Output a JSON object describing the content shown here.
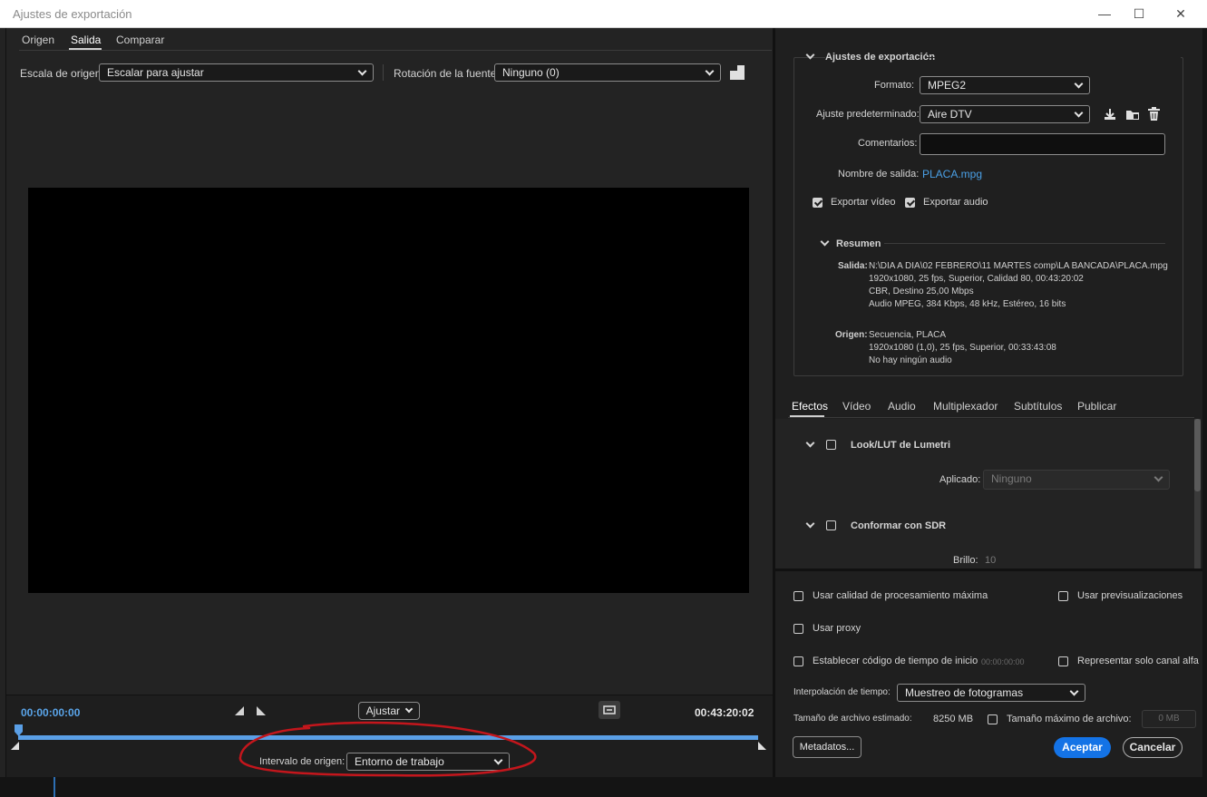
{
  "window": {
    "title": "Ajustes de exportación",
    "minimize": "—",
    "maximize": "☐",
    "close": "✕"
  },
  "left_tabs": [
    "Origen",
    "Salida",
    "Comparar"
  ],
  "source_scale": {
    "label": "Escala de origen:",
    "value": "Escalar para ajustar"
  },
  "rotation": {
    "label": "Rotación de la fuente:",
    "value": "Ninguno (0)"
  },
  "timeline": {
    "current_tc": "00:00:00:00",
    "end_tc": "00:43:20:02",
    "fit_label": "Ajustar",
    "source_range_label": "Intervalo de origen:",
    "source_range_value": "Entorno de trabajo",
    "playhead_progress": 0
  },
  "export_settings": {
    "header": "Ajustes de exportación",
    "format_label": "Formato:",
    "format_value": "MPEG2",
    "preset_label": "Ajuste predeterminado:",
    "preset_value": "Aire DTV",
    "comments_label": "Comentarios:",
    "comments_value": "",
    "output_name_label": "Nombre de salida:",
    "output_name_value": "PLACA.mpg",
    "export_video_label": "Exportar vídeo",
    "export_audio_label": "Exportar audio"
  },
  "summary": {
    "header": "Resumen",
    "output_label": "Salida:",
    "output_lines": [
      "N:\\DIA A DIA\\02 FEBRERO\\11 MARTES comp\\LA BANCADA\\PLACA.mpg",
      "1920x1080, 25 fps, Superior, Calidad 80, 00:43:20:02",
      "CBR, Destino 25,00 Mbps",
      "Audio MPEG, 384 Kbps, 48 kHz, Estéreo, 16 bits"
    ],
    "source_label": "Origen:",
    "source_lines": [
      "Secuencia, PLACA",
      "1920x1080 (1,0), 25 fps, Superior, 00:33:43:08",
      "No hay ningún audio"
    ]
  },
  "right_tabs": [
    "Efectos",
    "Vídeo",
    "Audio",
    "Multiplexador",
    "Subtítulos",
    "Publicar"
  ],
  "effects": {
    "lumetri_label": "Look/LUT de Lumetri",
    "applied_label": "Aplicado:",
    "applied_value": "Ninguno",
    "sdr_label": "Conformar con SDR",
    "brightness_label": "Brillo:",
    "brightness_value": "10"
  },
  "options": {
    "max_quality": "Usar calidad de procesamiento máxima",
    "use_previews": "Usar previsualizaciones",
    "use_proxy": "Usar proxy",
    "start_timecode": "Establecer código de tiempo de inicio",
    "start_timecode_value": "00:00:00:00",
    "alpha_only": "Representar solo canal alfa",
    "time_interp_label": "Interpolación de tiempo:",
    "time_interp_value": "Muestreo de fotogramas",
    "est_size_label": "Tamaño de archivo estimado:",
    "est_size_value": "8250 MB",
    "max_size_label": "Tamaño máximo de archivo:",
    "max_size_placeholder": "0 MB",
    "metadata_button": "Metadatos...",
    "accept_button": "Aceptar",
    "cancel_button": "Cancelar"
  },
  "colors": {
    "accent": "#1473e6",
    "link": "#4aa0e6",
    "timeline_bar": "#5a9fe6",
    "annotation": "#c4161c"
  },
  "icons": [
    "import-preset-icon",
    "save-preset-icon",
    "delete-preset-icon",
    "crop-icon",
    "mark-in-icon",
    "mark-out-icon",
    "loop-icon",
    "playhead-icon"
  ]
}
